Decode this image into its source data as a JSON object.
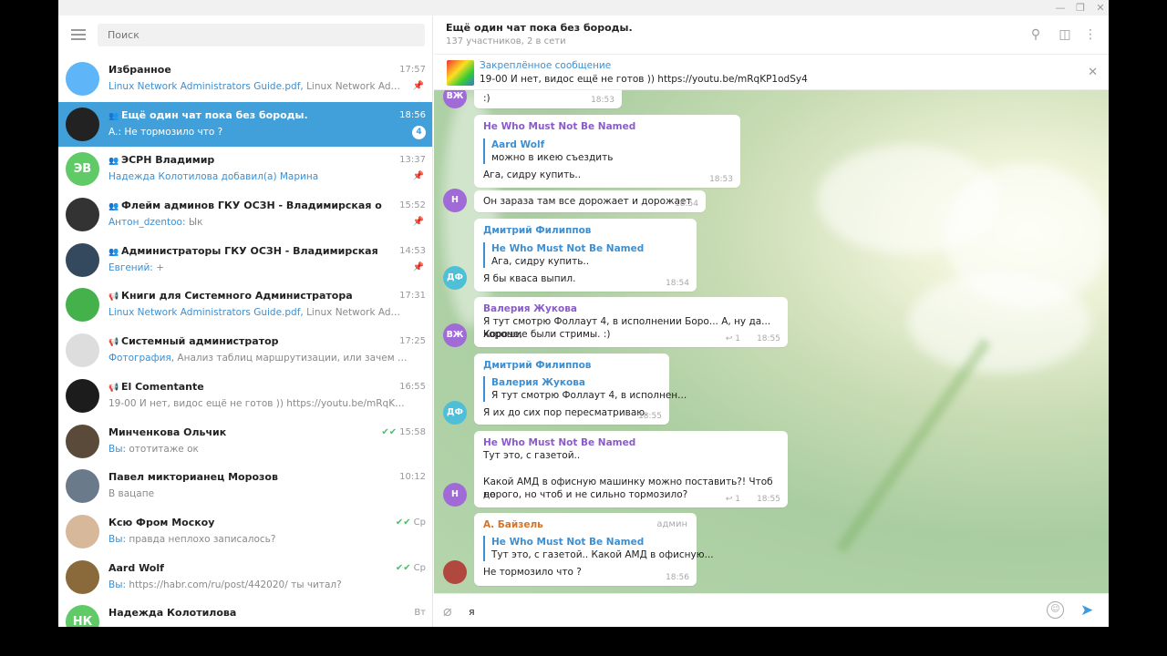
{
  "sidebar": {
    "search_placeholder": "Поиск",
    "dialogs": [
      {
        "name": "Избранное",
        "type": "",
        "time": "17:57",
        "who": "Linux Network Administrators Guide.pdf,",
        "text": " Linux Network Administr...",
        "pinned": true,
        "avatar_text": "",
        "avatar_color": "#5eb5f7"
      },
      {
        "name": "Ещё один чат пока без бороды.",
        "type": "group",
        "time": "18:56",
        "who": "А.:",
        "text": " Не тормозило что ?",
        "badge": "4",
        "avatar_text": "",
        "avatar_color": "#222222"
      },
      {
        "name": "ЭСРН Владимир",
        "type": "group",
        "time": "13:37",
        "who": "Надежда Колотилова добавил(а) Марина",
        "text": "",
        "pinned": true,
        "avatar_text": "ЭВ",
        "avatar_color": "#5fca66"
      },
      {
        "name": "Флейм админов ГКУ ОСЗН - Владимирская область",
        "type": "group",
        "time": "15:52",
        "who": "Антон_dzentoo:",
        "text": " Ык",
        "pinned": true,
        "avatar_text": "",
        "avatar_color": "#333333"
      },
      {
        "name": "Администраторы ГКУ ОСЗН - Владимирская область",
        "type": "group",
        "time": "14:53",
        "who": "Евгений:",
        "text": " +",
        "pinned": true,
        "avatar_text": "",
        "avatar_color": "#34495e"
      },
      {
        "name": "Книги для Системного Администратора",
        "type": "channel",
        "time": "17:31",
        "who": "Linux Network Administrators Guide.pdf,",
        "text": " Linux Network Administrators...",
        "avatar_text": "",
        "avatar_color": "#45b14a"
      },
      {
        "name": "Системный администратор",
        "type": "channel",
        "time": "17:25",
        "who": "Фотография,",
        "text": " Анализ таблиц маршрутизации, или зачем ещё сетево...",
        "avatar_text": "",
        "avatar_color": "#dddddd"
      },
      {
        "name": "El Comentante",
        "type": "channel",
        "time": "16:55",
        "who": "",
        "text": "19-00 И нет, видос ещё не готов )) https://youtu.be/mRqKP1odSy4",
        "avatar_text": "",
        "avatar_color": "#1c1c1c"
      },
      {
        "name": "Минченкова Ольчик",
        "type": "",
        "time": "15:58",
        "check": "✔✔",
        "who": "Вы:",
        "text": " ототитаже ок",
        "avatar_text": "",
        "avatar_color": "#5a4a3a"
      },
      {
        "name": "Павел микторианец Морозов",
        "type": "",
        "time": "10:12",
        "who": "",
        "text": "В вацапе",
        "avatar_text": "",
        "avatar_color": "#6a7a8a"
      },
      {
        "name": "Ксю Фром Москоу",
        "type": "",
        "time": "Ср",
        "check": "✔✔",
        "who": "Вы:",
        "text": " правда неплохо записалось?",
        "avatar_text": "",
        "avatar_color": "#d7b89a"
      },
      {
        "name": "Aard Wolf",
        "type": "",
        "time": "Ср",
        "check": "✔✔",
        "who": "Вы:",
        "text": " https://habr.com/ru/post/442020/ ты читал?",
        "avatar_text": "",
        "avatar_color": "#8a6a3a"
      },
      {
        "name": "Надежда Колотилова",
        "type": "",
        "time": "Вт",
        "who": "",
        "text": "",
        "avatar_text": "НК",
        "avatar_color": "#5fca66"
      }
    ]
  },
  "chat": {
    "title": "Ещё один чат пока без бороды.",
    "subtitle": "137 участников, 2 в сети",
    "pinned_label": "Закреплённое сообщение",
    "pinned_text": "19-00 И нет, видос ещё не готов )) https://youtu.be/mRqKP1odSy4",
    "input_value": "я",
    "messages": [
      {
        "text": ":)",
        "time": "18:53"
      },
      {
        "author": "He Who Must Not Be Named",
        "reply_name": "Aard Wolf",
        "reply_text": "можно в икею съездить",
        "text": "Ага, сидру купить..",
        "time": "18:53"
      },
      {
        "text": "Он зараза там все дорожает и дорожает",
        "time": "18:54"
      },
      {
        "author": "Дмитрий Филиппов",
        "reply_name": "He Who Must Not Be Named",
        "reply_text": "Ага, сидру купить..",
        "text": "Я бы кваса выпил.",
        "time": "18:54"
      },
      {
        "author": "Валерия Жукова",
        "text1": "Я тут смотрю Фоллаут 4, в исполнении Боро... А, ну да... Короче,",
        "text2": "хорошие были стримы. :)",
        "fwd": "↩ 1",
        "time": "18:55"
      },
      {
        "author": "Дмитрий Филиппов",
        "reply_name": "Валерия Жукова",
        "reply_text": "Я тут смотрю Фоллаут 4, в исполнен...",
        "text": "Я их до сих пор пересматриваю.",
        "time": "18:55"
      },
      {
        "author": "He Who Must Not Be Named",
        "text1": "Тут это, с газетой..",
        "text2": "Какой АМД в офисную машинку можно поставить?! Чтоб не",
        "text3": "дорого, но чтоб и не сильно тормозило?",
        "fwd": "↩ 1",
        "time": "18:55"
      },
      {
        "author": "А. Байзель",
        "admin": "админ",
        "reply_name": "He Who Must Not Be Named",
        "reply_text": "Тут это, с газетой..  Какой АМД в офисную...",
        "text": "Не тормозило что ?",
        "time": "18:56"
      }
    ],
    "avatars": [
      "ВЖ",
      "Н",
      "ДФ",
      "ВЖ",
      "ДФ",
      "Н"
    ]
  },
  "colors": {
    "accent": "#419fd9",
    "author_he": "#8a5cc7",
    "author_dima": "#3d8fd1",
    "author_valeria": "#8a5cc7",
    "author_baizel": "#d2742d"
  }
}
